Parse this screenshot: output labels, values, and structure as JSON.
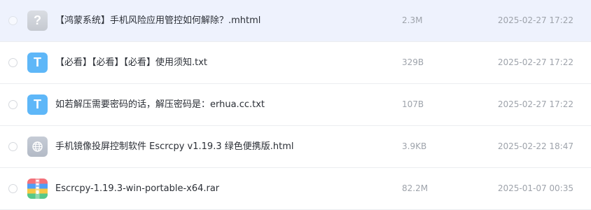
{
  "files": [
    {
      "name": "【鸿蒙系统】手机风险应用管控如何解除？.mhtml",
      "size": "2.3M",
      "date": "2025-02-27 17:22",
      "icon": "unknown-file-icon",
      "icon_glyph": "?",
      "selected": true
    },
    {
      "name": "【必看】【必看】【必看】使用须知.txt",
      "size": "329B",
      "date": "2025-02-27 17:22",
      "icon": "text-file-icon",
      "icon_glyph": "T",
      "selected": false
    },
    {
      "name": "如若解压需要密码的话，解压密码是：erhua.cc.txt",
      "size": "107B",
      "date": "2025-02-27 17:22",
      "icon": "text-file-icon",
      "icon_glyph": "T",
      "selected": false
    },
    {
      "name": "手机镜像投屏控制软件 Escrcpy v1.19.3 绿色便携版.html",
      "size": "3.9KB",
      "date": "2025-02-22 18:47",
      "icon": "html-file-icon",
      "selected": false
    },
    {
      "name": "Escrcpy-1.19.3-win-portable-x64.rar",
      "size": "82.2M",
      "date": "2025-01-07 00:35",
      "icon": "archive-file-icon",
      "selected": false
    }
  ],
  "colors": {
    "selected_row_bg": "#eef2fd",
    "text_icon_blue": "#5eb7f8",
    "meta_text": "#9ea3ab",
    "name_text": "#2b2f36"
  }
}
